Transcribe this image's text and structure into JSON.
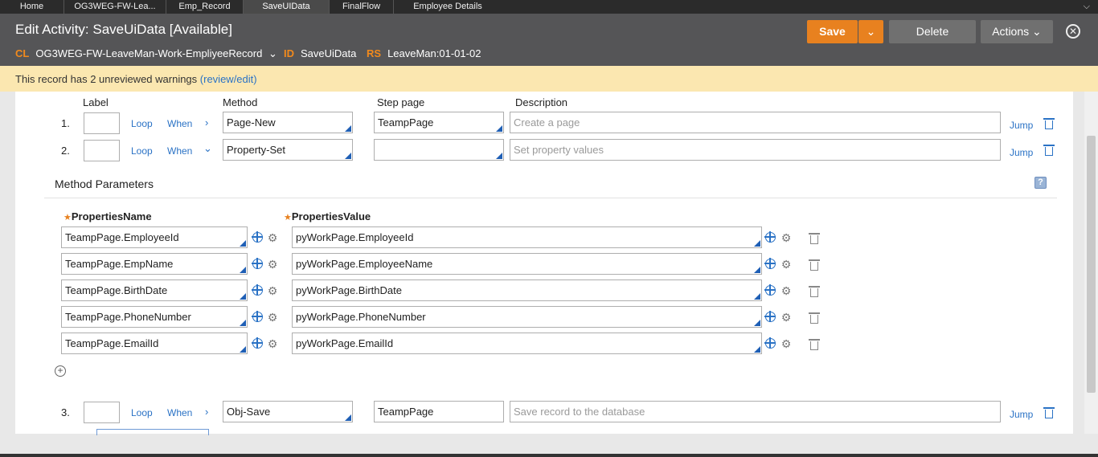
{
  "tabs": [
    {
      "label": "Home"
    },
    {
      "label": "OG3WEG-FW-Lea..."
    },
    {
      "label": "Emp_Record"
    },
    {
      "label": "SaveUIData"
    },
    {
      "label": "FinalFlow"
    },
    {
      "label": "Employee Details"
    }
  ],
  "header": {
    "title": "Edit Activity: SaveUiData [Available]",
    "cl_label": "CL",
    "cl_value": "OG3WEG-FW-LeaveMan-Work-EmpliyeeRecord",
    "id_label": "ID",
    "id_value": "SaveUiData",
    "rs_label": "RS",
    "rs_value": "LeaveMan:01-01-02",
    "save_label": "Save",
    "delete_label": "Delete",
    "actions_label": "Actions"
  },
  "warning": {
    "text": "This record has 2 unreviewed warnings",
    "link": "(review/edit)"
  },
  "columns": {
    "label": "Label",
    "method": "Method",
    "step_page": "Step page",
    "description": "Description"
  },
  "steps": [
    {
      "num": "1.",
      "loop": "Loop",
      "when": "When",
      "method": "Page-New",
      "step_page": "TeampPage",
      "description": "Create a page",
      "jump": "Jump"
    },
    {
      "num": "2.",
      "loop": "Loop",
      "when": "When",
      "method": "Property-Set",
      "step_page": "",
      "description": "Set property values",
      "jump": "Jump"
    },
    {
      "num": "3.",
      "loop": "Loop",
      "when": "When",
      "method": "Obj-Save",
      "step_page": "TeampPage",
      "description": "Save record to the database",
      "jump": "Jump"
    }
  ],
  "method_parameters": {
    "title": "Method Parameters",
    "name_header": "PropertiesName",
    "value_header": "PropertiesValue",
    "rows": [
      {
        "name": "TeampPage.EmployeeId",
        "value": "pyWorkPage.EmployeeId"
      },
      {
        "name": "TeampPage.EmpName",
        "value": "pyWorkPage.EmployeeName"
      },
      {
        "name": "TeampPage.BirthDate",
        "value": "pyWorkPage.BirthDate"
      },
      {
        "name": "TeampPage.PhoneNumber",
        "value": "pyWorkPage.PhoneNumber"
      },
      {
        "name": "TeampPage.EmailId",
        "value": "pyWorkPage.EmailId"
      }
    ]
  },
  "colors": {
    "accent": "#e8811f",
    "header_bg": "#555557",
    "warning_bg": "#fbe7b0",
    "link": "#2a72c5"
  },
  "icons": [
    "chevron-down-icon",
    "close-icon",
    "trash-icon",
    "crosshair-icon",
    "gear-icon",
    "help-icon",
    "add-icon",
    "chevron-right-icon"
  ]
}
